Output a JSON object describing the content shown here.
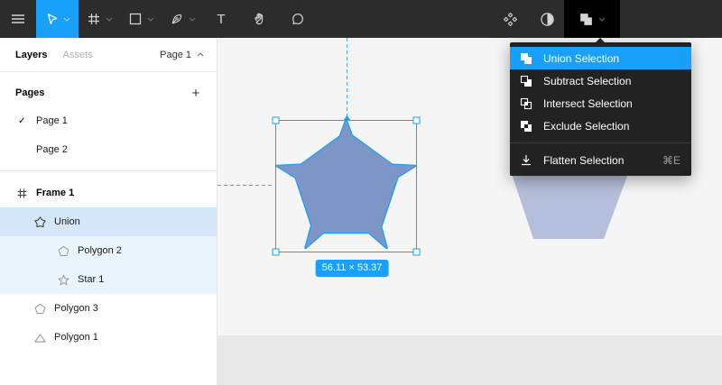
{
  "colors": {
    "accent": "#18a0fb",
    "toolbar_bg": "#2c2c2c",
    "menu_bg": "#222222",
    "shape_fill": "#7e96c6",
    "shape_fill_light": "#b5bedb"
  },
  "toolbar": {
    "tools": [
      "menu",
      "move",
      "frame",
      "shape",
      "pen",
      "text",
      "hand",
      "comment"
    ],
    "right_tools": [
      "component",
      "mask",
      "boolean-operations"
    ],
    "text_tool_glyph": "T"
  },
  "menu": {
    "items": [
      {
        "label": "Union Selection",
        "icon": "union-boolean-icon",
        "highlighted": true
      },
      {
        "label": "Subtract Selection",
        "icon": "subtract-boolean-icon",
        "highlighted": false
      },
      {
        "label": "Intersect Selection",
        "icon": "intersect-boolean-icon",
        "highlighted": false
      },
      {
        "label": "Exclude Selection",
        "icon": "exclude-boolean-icon",
        "highlighted": false
      }
    ],
    "flatten": {
      "label": "Flatten Selection",
      "shortcut": "⌘E",
      "icon": "flatten-icon"
    }
  },
  "sidebar": {
    "tab_layers": "Layers",
    "tab_assets": "Assets",
    "page_selector": "Page 1",
    "pages_title": "Pages",
    "add_page": "+",
    "check": "✓",
    "pages": [
      {
        "label": "Page 1",
        "current": true
      },
      {
        "label": "Page 2",
        "current": false
      }
    ],
    "layers": [
      {
        "label": "Frame 1",
        "icon": "frame",
        "indent": 0
      },
      {
        "label": "Union",
        "icon": "union-shape",
        "indent": 1,
        "state": "selected"
      },
      {
        "label": "Polygon 2",
        "icon": "pentagon",
        "indent": 2,
        "state": "child"
      },
      {
        "label": "Star 1",
        "icon": "star",
        "indent": 2,
        "state": "child"
      },
      {
        "label": "Polygon 3",
        "icon": "pentagon",
        "indent": 1
      },
      {
        "label": "Polygon 1",
        "icon": "triangle",
        "indent": 1
      }
    ]
  },
  "canvas": {
    "dimension_label": "56.11 × 53.37"
  }
}
